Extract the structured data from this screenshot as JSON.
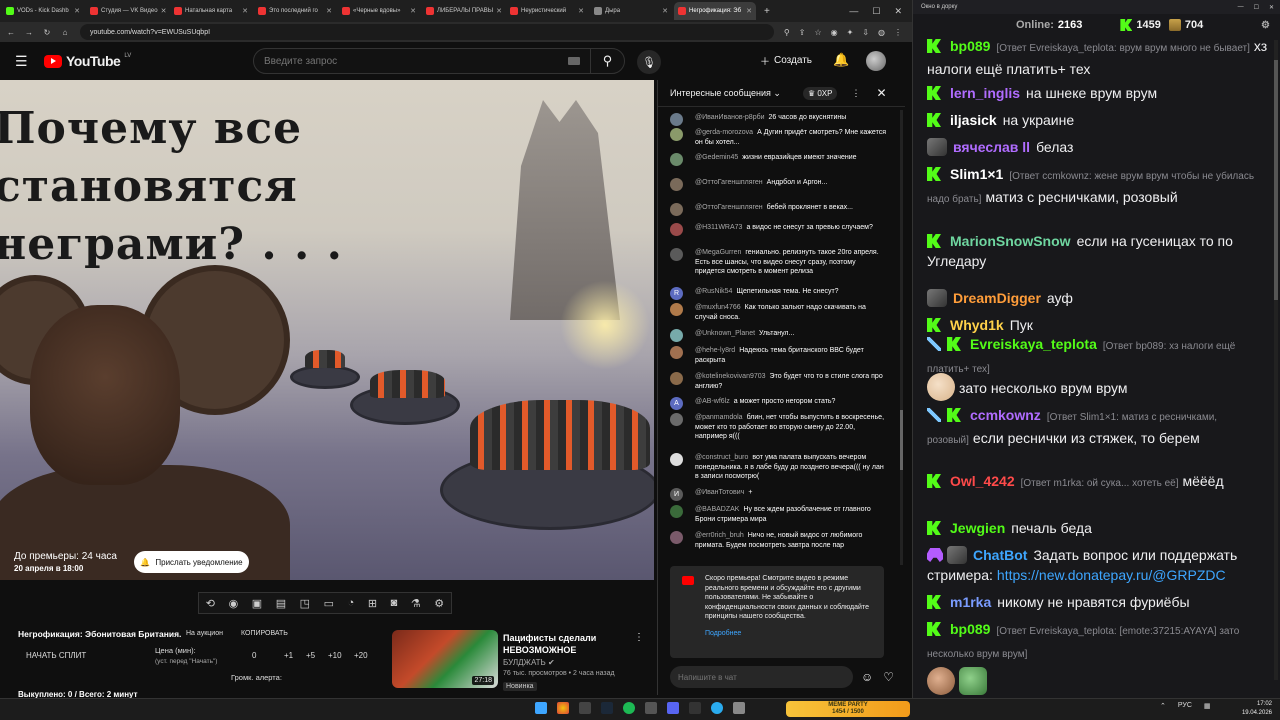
{
  "browser": {
    "tabs": [
      {
        "label": "VODs - Kick Dashb",
        "color": "#53fc18",
        "active": false
      },
      {
        "label": "Студия — VK Видео",
        "color": "#e33",
        "active": false
      },
      {
        "label": "Натальная карта",
        "color": "#e33",
        "active": false
      },
      {
        "label": "Это последний го",
        "color": "#e33",
        "active": false
      },
      {
        "label": "«Черные вдовы»",
        "color": "#e33",
        "active": false
      },
      {
        "label": "ЛИБЕРАЛЫ ПРАВЫ",
        "color": "#e33",
        "active": false
      },
      {
        "label": "Неуристический",
        "color": "#e33",
        "active": false
      },
      {
        "label": "Дыра",
        "color": "#888",
        "active": false
      },
      {
        "label": "Негрофикация: Эб",
        "color": "#e33",
        "active": true
      }
    ],
    "url": "youtube.com/watch?v=EWUSuSUqbpI"
  },
  "youtube": {
    "logo": "YouTube",
    "logo_region": "LV",
    "search_placeholder": "Введите запрос",
    "create_label": "Создать"
  },
  "video": {
    "title_overlay": "Почему все становятся неграми? . . .",
    "premiere_countdown": "До премьеры: 24 часа",
    "premiere_date": "20 апреля в 18:00",
    "notify_label": "Прислать уведомление"
  },
  "below_video": {
    "split_name": "Негрофикация: Эбонитовая Британия.",
    "auction": "На аукцион",
    "copy": "КОПИРОВАТЬ",
    "start_split": "НАЧАТЬ СПЛИТ",
    "price_label": "Цена (мин):",
    "price_hint": "(уст. перед \"Начать\")",
    "price_value": "0",
    "steps": [
      "+1",
      "+5",
      "+10",
      "+20"
    ],
    "alert_volume": "Громк. алерта:",
    "footer": "Выкуплено: 0 / Всего: 2 минут"
  },
  "recommendation": {
    "title": "Пацифисты сделали НЕВОЗМОЖНОЕ",
    "channel": "БУЛДЖАТЬ",
    "meta": "76 тыс. просмотров • 2 часа назад",
    "badge": "Новинка",
    "duration": "27:18"
  },
  "yt_chat": {
    "mode": "Интересные сообщения",
    "xp": "0XP",
    "messages": [
      {
        "author": "@ИванИванов-р8рби",
        "text": "26 часов до вкуснятины",
        "avatar": "#6a7a8a",
        "letter": ""
      },
      {
        "author": "@gerda-morozova",
        "text": "А Дугин придёт смотреть? Мне кажется он бы хотел...",
        "avatar": "#8a9a6a",
        "letter": ""
      },
      {
        "author": "@Gedemin45",
        "text": "жизни евразийцев имеют значение",
        "avatar": "#6a8a6a",
        "letter": ""
      },
      {
        "author": "@ОттоГагеншпляген",
        "text": "Андрбол и Аргон...",
        "avatar": "#7a6a5a",
        "letter": ""
      },
      {
        "author": "@ОттоГагеншпляген",
        "text": "бебей проклянет в веках...",
        "avatar": "#7a6a5a",
        "letter": ""
      },
      {
        "author": "@H311WRA73",
        "text": "а видос не снесут за превью случаем?",
        "avatar": "#9a4a4a",
        "letter": ""
      },
      {
        "author": "@MegaGurren",
        "text": "гениально. релизнуть такое 20го апреля. Есть все шансы, что видео снесут сразу, поэтому придется смотреть в момент релиза",
        "avatar": "#5a5a5a",
        "letter": ""
      },
      {
        "author": "@RusNik54",
        "text": "Щепетильная тема. Не снесут?",
        "avatar": "#5c6bc0",
        "letter": "R"
      },
      {
        "author": "@muxfun4766",
        "text": "Как только зальют надо скачивать на случай сноса.",
        "avatar": "#b07a4a",
        "letter": ""
      },
      {
        "author": "@Unknown_Planet",
        "text": "Ультанул...",
        "avatar": "#7aa",
        "letter": ""
      },
      {
        "author": "@hehe-ly8rd",
        "text": "Надеюсь тема британского ВВС будет раскрыта",
        "avatar": "#a07050",
        "letter": ""
      },
      {
        "author": "@kotelinekovivan9703",
        "text": "Это будет что то в стиле слога про англию?",
        "avatar": "#8a6a4a",
        "letter": ""
      },
      {
        "author": "@AB-wf6lz",
        "text": "а может просто негором стать?",
        "avatar": "#5c6bc0",
        "letter": "A"
      },
      {
        "author": "@panmamdola",
        "text": "блин, нет чтобы выпустить в воскресенье, может кто то работает во вторую смену до 22.00, например я(((",
        "avatar": "#6a6a6a",
        "letter": ""
      },
      {
        "author": "@construct_buro",
        "text": "вот ума палата выпускать вечером понедельника. я в лабе буду до позднего вечера((( ну лан в записи посмотрю(",
        "avatar": "#ddd",
        "letter": ""
      },
      {
        "author": "@ИванТотович",
        "text": "+",
        "avatar": "#5a5a5a",
        "letter": "И"
      },
      {
        "author": "@BABADZAK",
        "text": "Ну все ждем разоблачение от главного Брони стримера мира",
        "avatar": "#3a6a3a",
        "letter": ""
      },
      {
        "author": "@err0rich_bruh",
        "text": "Ничо не, новый видос от любимого примата. Будем посмотреть завтра после пар",
        "avatar": "#7a5a6a",
        "letter": ""
      }
    ],
    "notice": "Скоро премьера! Смотрите видео в режиме реального времени и обсуждайте его с другими пользователями. Не забывайте о конфиденциальности своих данных и соблюдайте принципы нашего сообщества.",
    "notice_link": "Подробнее",
    "input_placeholder": "Напишите в чат"
  },
  "kick": {
    "window_title": "Окно в дорку",
    "online_label": "Online:",
    "online_value": "2163",
    "followers": "1459",
    "subs": "704",
    "messages": [
      {
        "badge": "k",
        "user": "bp089",
        "color": "#53fc18",
        "reply": "[Ответ Evreiskaya_teplota: врум врум много не бывает]",
        "text": "хз налоги ещё платить+ тех"
      },
      {
        "badge": "k",
        "user": "lern_inglis",
        "color": "#b06cff",
        "reply": "",
        "text": "на шнеке врум врум"
      },
      {
        "badge": "k",
        "user": "iljasick",
        "color": "#ffffff",
        "reply": "",
        "text": "на украине"
      },
      {
        "badge": "avatar",
        "user": "вячеслав ll",
        "color": "#b06cff",
        "reply": "",
        "text": "белаз"
      },
      {
        "badge": "k",
        "user": "Slim1×1",
        "color": "#ffffff",
        "reply": "[Ответ ccmkownz: жене врум врум чтобы не убилась надо брать]",
        "text": "матиз с ресничками, розовый"
      },
      {
        "badge": "k",
        "user": "MarionSnowSnow",
        "color": "#6fd6a0",
        "reply": "",
        "text": "если на гусеницах то по Угледару"
      },
      {
        "badge": "avatar",
        "user": "DreamDigger",
        "color": "#ff9d3a",
        "reply": "",
        "text": "ауф"
      },
      {
        "badge": "k",
        "user": "Whyd1k",
        "color": "#ffd24a",
        "reply": "",
        "text": "Пук"
      },
      {
        "badge": "sword-k",
        "user": "Evreiskaya_teplota",
        "color": "#53fc18",
        "reply": "[Ответ bp089: хз налоги ещё платить+ тех]",
        "text": ""
      },
      {
        "badge": "emote",
        "user": "",
        "color": "#ffffff",
        "reply": "",
        "text": "зато несколько врум врум"
      },
      {
        "badge": "sword-k",
        "user": "ccmkownz",
        "color": "#b06cff",
        "reply": "[Ответ Slim1×1: матиз с ресничками, розовый]",
        "text": "если реснички из стяжек, то берем"
      },
      {
        "badge": "k",
        "user": "Owl_4242",
        "color": "#ff4a4a",
        "reply": "[Ответ m1rka: ой сука... хотеть её]",
        "text": "мёёёд"
      },
      {
        "badge": "k",
        "user": "Jewgien",
        "color": "#53fc18",
        "reply": "",
        "text": "печаль беда"
      },
      {
        "badge": "invader",
        "user": "ChatBot",
        "color": "#3ea6ff",
        "reply": "",
        "text": "Задать вопрос или поддержать стримера:",
        "link": "https://new.donatepay.ru/@GRPZDC"
      },
      {
        "badge": "k",
        "user": "m1rka",
        "color": "#7a9cff",
        "reply": "",
        "text": "никому не нравятся фуриёбы"
      },
      {
        "badge": "k",
        "user": "bp089",
        "color": "#53fc18",
        "reply": "[Ответ Evreiskaya_teplota: [emote:37215:AYAYA] зато несколько врум врум]",
        "text": ""
      }
    ]
  },
  "taskbar": {
    "meme_title": "MEME PARTY",
    "meme_sub": "1454 / 1500",
    "lang": "РУС",
    "time": "17:02",
    "date": "19.04.2026"
  }
}
